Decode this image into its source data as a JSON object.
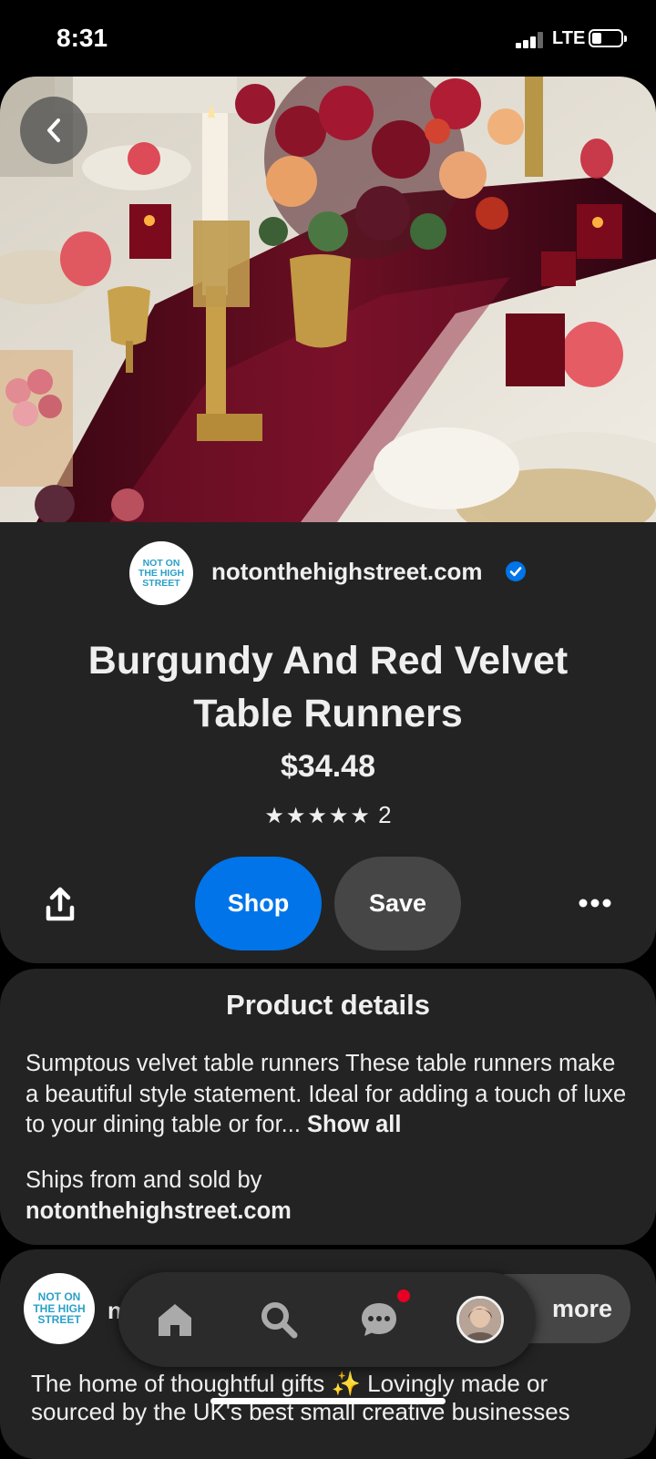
{
  "status_bar": {
    "time": "8:31",
    "network": "LTE"
  },
  "merchant": {
    "logo_lines": [
      "NOT ON",
      "THE HIGH",
      "STREET"
    ],
    "name": "notonthehighstreet.com"
  },
  "pin": {
    "title": "Burgundy And Red Velvet Table Runners",
    "price": "$34.48",
    "stars": "★★★★★",
    "rating_count": "2"
  },
  "actions": {
    "shop_label": "Shop",
    "save_label": "Save"
  },
  "product_details": {
    "title": "Product details",
    "description": "Sumptous velvet table runners These table runners make a beautiful style statement. Ideal for adding a touch of luxe to your dining table or for...",
    "show_all": "Show all",
    "ships_label": "Ships from and sold by",
    "seller": "notonthehighstreet.com"
  },
  "about": {
    "logo_lines": [
      "NOT ON",
      "THE HIGH",
      "STREET"
    ],
    "name_fragment": "n",
    "see_more_label": "more",
    "description": "The home of thoughtful gifts ✨ Lovingly made or sourced by the UK's best small creative businesses"
  },
  "colors": {
    "accent_blue": "#0074e8",
    "notification_red": "#e60023",
    "card_bg": "#232323"
  }
}
